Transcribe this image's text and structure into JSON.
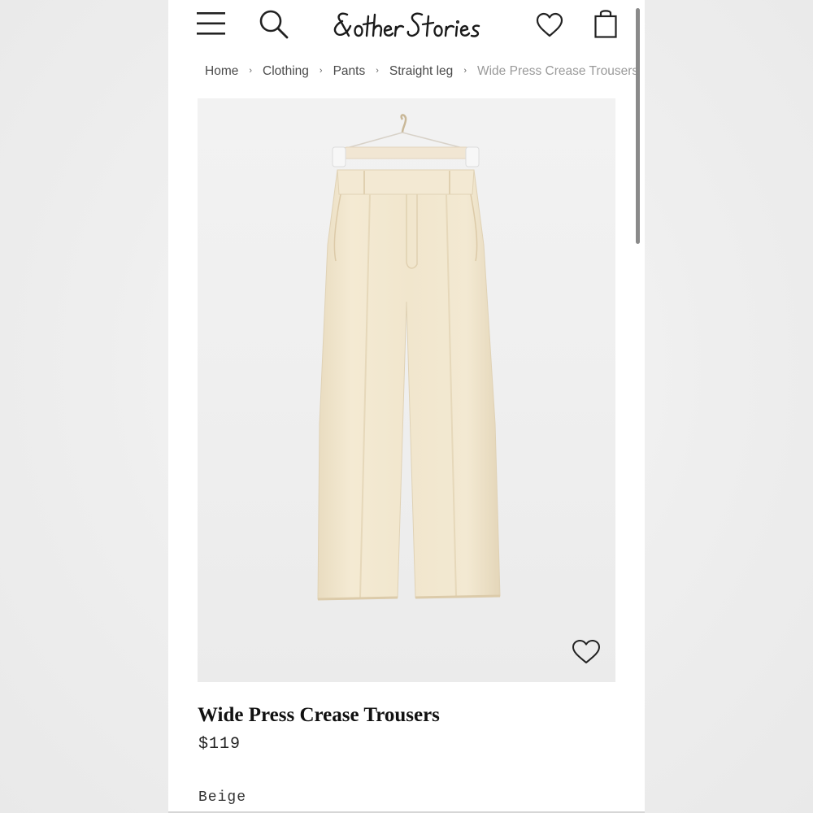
{
  "brand": {
    "logo_text": "& other Stories"
  },
  "header": {
    "icons": [
      "menu-icon",
      "search-icon",
      "heart-icon",
      "shopping-bag-icon"
    ]
  },
  "breadcrumb": [
    {
      "label": "Home"
    },
    {
      "label": "Clothing"
    },
    {
      "label": "Pants"
    },
    {
      "label": "Straight leg"
    },
    {
      "label": "Wide Press Crease Trousers"
    }
  ],
  "breadcrumb_separator": "›",
  "product": {
    "title": "Wide Press Crease Trousers",
    "price": "$119",
    "color": "Beige",
    "swatch_hex": "#efe4cc"
  },
  "colors": {
    "page_bg": "#eeeeee",
    "surface": "#ffffff",
    "text": "#111111",
    "current_crumb": "#9a9a9a"
  }
}
